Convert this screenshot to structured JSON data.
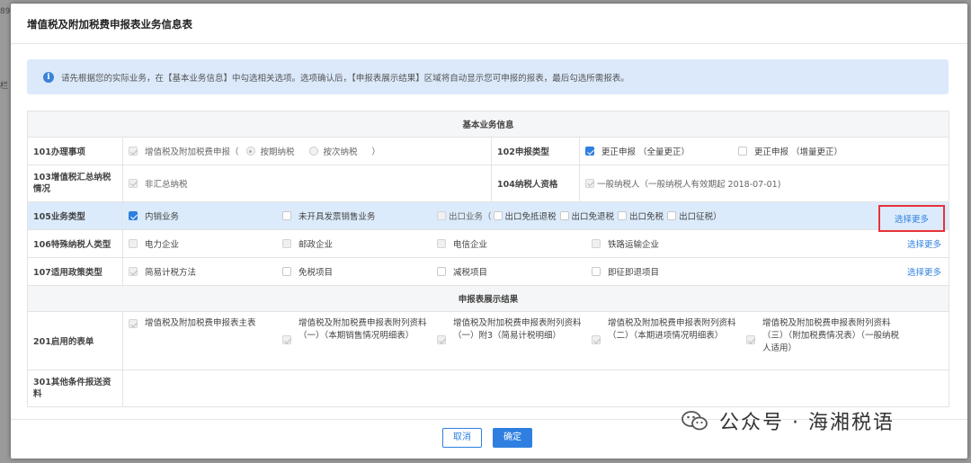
{
  "background": {
    "left_text_1": "89",
    "left_text_2": "栏"
  },
  "dialog": {
    "title": "增值税及附加税费申报表业务信息表",
    "notice": "请先根据您的实际业务，在【基本业务信息】中勾选相关选项。选项确认后，【申报表展示结果】区域将自动显示您可申报的报表，最后勾选所需报表。",
    "section_basic": "基本业务信息",
    "section_result": "申报表展示结果",
    "row101": {
      "label": "101办理事项",
      "option_main": "增值税及附加税费申报（",
      "radio1": "按期纳税",
      "radio2": "按次纳税",
      "close_paren": "）"
    },
    "row102": {
      "label": "102申报类型",
      "option1": "更正申报 （全量更正）",
      "option2": "更正申报 （增量更正）"
    },
    "row103": {
      "label": "103增值税汇总纳税情况",
      "option": "非汇总纳税"
    },
    "row104": {
      "label": "104纳税人资格",
      "option": "一般纳税人（一般纳税人有效期起 2018-07-01)"
    },
    "row105": {
      "label": "105业务类型",
      "options": [
        "内销业务",
        "未开具发票销售业务",
        "出口业务（",
        "出口免抵退税",
        "出口免退税",
        "出口免税",
        "出口征税）"
      ],
      "more": "选择更多"
    },
    "row106": {
      "label": "106特殊纳税人类型",
      "options": [
        "电力企业",
        "邮政企业",
        "电信企业",
        "铁路运输企业"
      ],
      "more": "选择更多"
    },
    "row107": {
      "label": "107适用政策类型",
      "options": [
        "简易计税方法",
        "免税项目",
        "减税项目",
        "即征即退项目"
      ],
      "more": "选择更多"
    },
    "row201": {
      "label": "201启用的表单",
      "forms": [
        "增值税及附加税费申报表主表",
        "增值税及附加税费申报表附列资料（一）（本期销售情况明细表）",
        "增值税及附加税费申报表附列资料（一）附3（简易计税明细）",
        "增值税及附加税费申报表附列资料（二）（本期进项情况明细表）",
        "增值税及附加税费申报表附列资料（三）（附加税费情况表）（一般纳税人适用）"
      ]
    },
    "row301": {
      "label": "301其他条件报送资料"
    },
    "buttons": {
      "cancel": "取消",
      "ok": "确定"
    }
  },
  "watermark": {
    "text": "公众号 · 海湘税语"
  },
  "colors": {
    "accent": "#2f7fe0",
    "highlight_row": "#dcebfb",
    "red_box": "#e8323a",
    "notice_bg": "#dbe9fb"
  }
}
